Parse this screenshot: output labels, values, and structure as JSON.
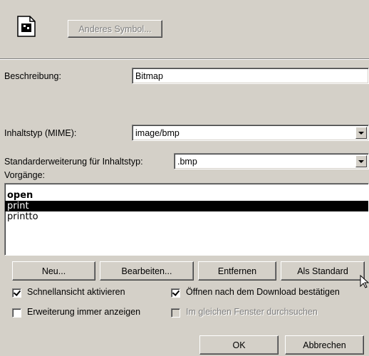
{
  "icon_area": {
    "file_icon": "document-icon",
    "change_icon_button": "Anderes Symbol..."
  },
  "description": {
    "label": "Beschreibung:",
    "value": "Bitmap"
  },
  "mime": {
    "label": "Inhaltstyp (MIME):",
    "value": "image/bmp"
  },
  "extension": {
    "label": "Standarderweiterung für Inhaltstyp:",
    "value": ".bmp"
  },
  "actions": {
    "label": "Vorgänge:",
    "items": [
      "open",
      "print",
      "printto"
    ],
    "default_item": "open",
    "selected_item": "print"
  },
  "buttons": {
    "new": "Neu...",
    "edit": "Bearbeiten...",
    "remove": "Entfernen",
    "set_default": "Als Standard",
    "ok": "OK",
    "cancel": "Abbrechen"
  },
  "options": {
    "quickview": {
      "label": "Schnellansicht aktivieren",
      "checked": true
    },
    "confirm_open": {
      "label": "Öffnen nach dem Download bestätigen",
      "checked": true
    },
    "always_show_ext": {
      "label": "Erweiterung immer anzeigen",
      "checked": false
    },
    "same_window": {
      "label": "Im gleichen Fenster durchsuchen",
      "checked": false,
      "enabled": false
    }
  },
  "colors": {
    "face": "#d4d0c8",
    "shadow": "#808080",
    "highlight": "#ffffff",
    "selection": "#000000"
  }
}
